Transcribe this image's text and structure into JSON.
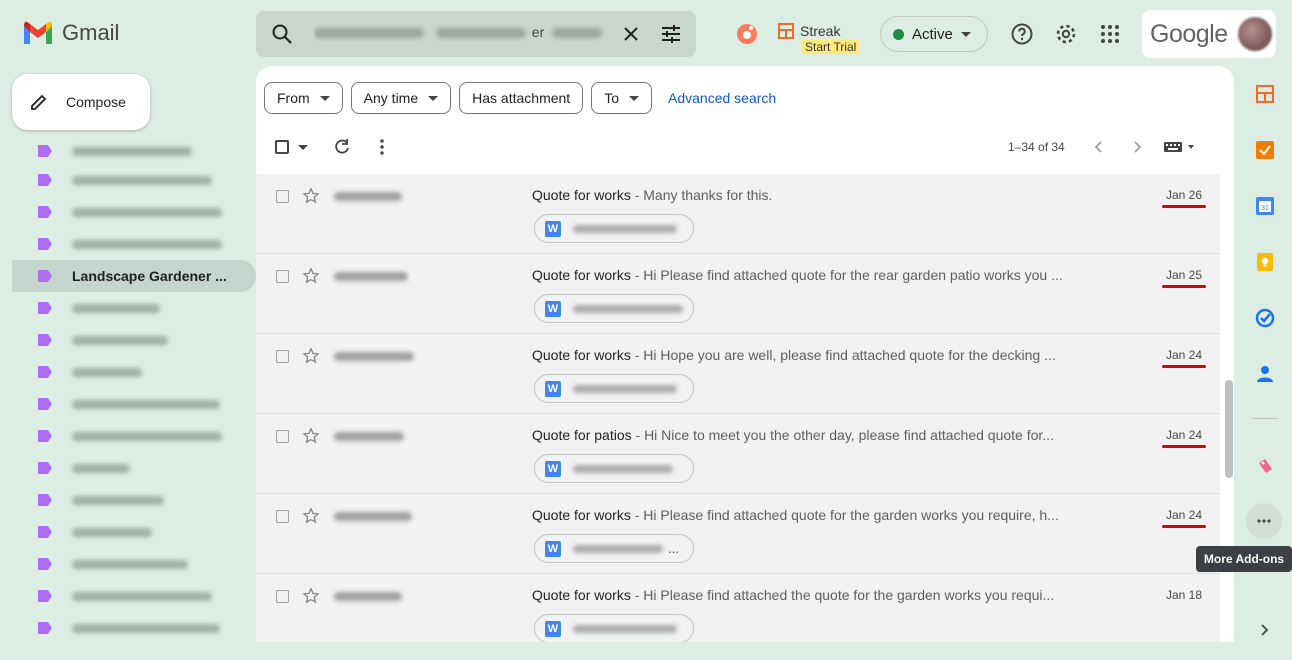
{
  "app": {
    "name": "Gmail"
  },
  "search": {
    "query_visible": "er"
  },
  "header": {
    "streak_label": "Streak",
    "streak_trial": "Start Trial",
    "status": "Active",
    "google_label": "Google"
  },
  "sidebar": {
    "compose_label": "Compose",
    "selected_label": "Landscape Gardener ...",
    "label_count_above": 4,
    "label_count_below": 11
  },
  "filters": {
    "chips": [
      "From",
      "Any time",
      "Has attachment",
      "To"
    ],
    "advanced": "Advanced search"
  },
  "toolbar": {
    "count": "1–34 of 34"
  },
  "emails": [
    {
      "subject": "Quote for works",
      "snippet": " - Many thanks for this.",
      "date": "Jan 26",
      "marked": true,
      "attach_ellipsis": ""
    },
    {
      "subject": "Quote for works",
      "snippet": " - Hi       Please find attached quote for the rear garden patio works you ...",
      "date": "Jan 25",
      "marked": true,
      "attach_ellipsis": ""
    },
    {
      "subject": "Quote for works",
      "snippet": " - Hi        Hope you are well, please find attached quote for the decking ...",
      "date": "Jan 24",
      "marked": true,
      "attach_ellipsis": ""
    },
    {
      "subject": "Quote for patios",
      "snippet": " - Hi       Nice to meet you the other day, please find attached quote for...",
      "date": "Jan 24",
      "marked": true,
      "attach_ellipsis": ""
    },
    {
      "subject": "Quote for works",
      "snippet": " - Hi       Please find attached quote for the garden works you require, h...",
      "date": "Jan 24",
      "marked": true,
      "attach_ellipsis": "..."
    },
    {
      "subject": "Quote for works",
      "snippet": " - Hi        Please find attached the quote for the garden works you requi...",
      "date": "Jan 18",
      "marked": false,
      "attach_ellipsis": ""
    }
  ],
  "right_rail": {
    "tooltip": "More Add-ons"
  },
  "colors": {
    "background": "#dcede3",
    "label": "#b16cf0",
    "date_mark": "#e00000",
    "link": "#0b57d0",
    "active_dot": "#1e8e3e"
  }
}
